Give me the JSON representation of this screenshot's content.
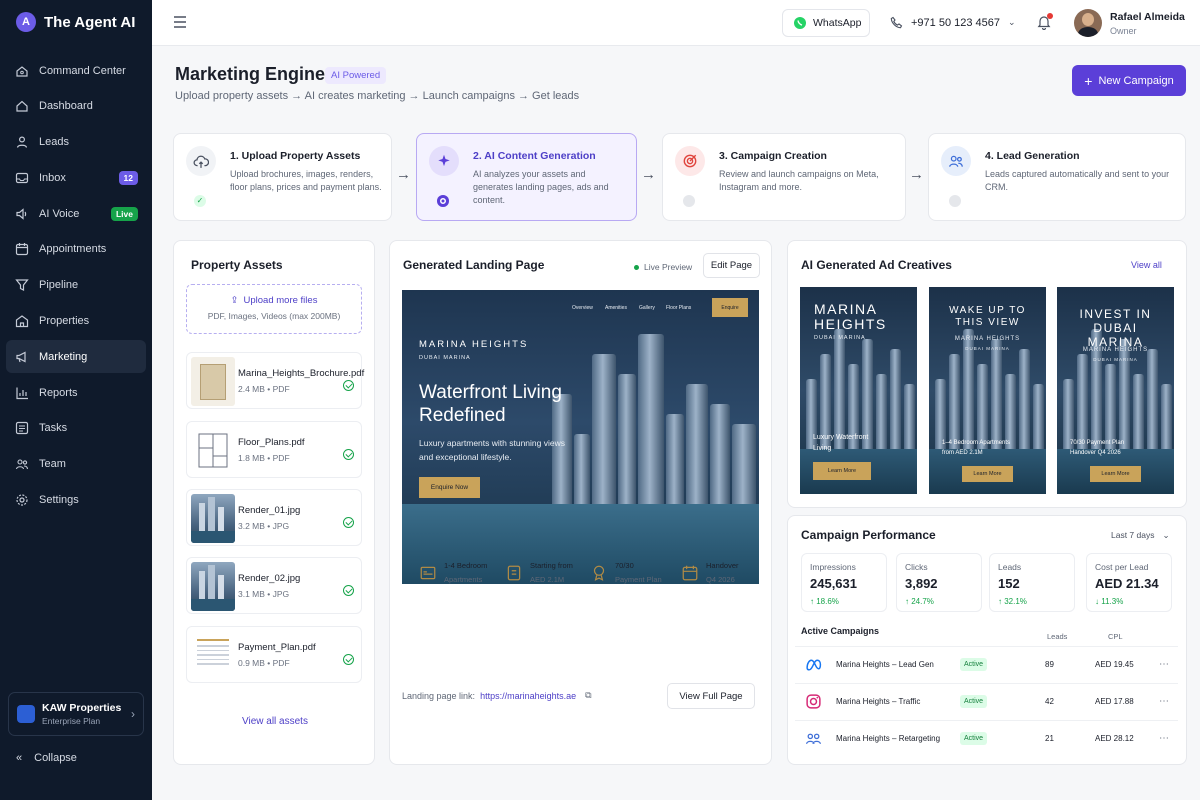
{
  "app": {
    "name": "The Agent AI",
    "logo_mark": "A"
  },
  "sidebar": {
    "items": [
      {
        "label": "Command Center",
        "icon": "home-icon"
      },
      {
        "label": "Dashboard",
        "icon": "dashboard-icon"
      },
      {
        "label": "Leads",
        "icon": "user-icon"
      },
      {
        "label": "Inbox",
        "icon": "inbox-icon",
        "badge": "12"
      },
      {
        "label": "AI Voice",
        "icon": "voice-icon",
        "badge": "Live"
      },
      {
        "label": "Appointments",
        "icon": "calendar-icon"
      },
      {
        "label": "Pipeline",
        "icon": "filter-icon"
      },
      {
        "label": "Properties",
        "icon": "building-icon"
      },
      {
        "label": "Marketing",
        "icon": "megaphone-icon",
        "active": true
      },
      {
        "label": "Reports",
        "icon": "chart-icon"
      },
      {
        "label": "Tasks",
        "icon": "tasks-icon"
      },
      {
        "label": "Team",
        "icon": "team-icon"
      },
      {
        "label": "Settings",
        "icon": "gear-icon"
      }
    ],
    "workspace": {
      "name": "KAW Properties",
      "plan": "Enterprise Plan"
    },
    "collapse_label": "Collapse"
  },
  "topbar": {
    "whatsapp_label": "WhatsApp",
    "phone": "+971 50 123 4567",
    "user": {
      "name": "Rafael Almeida",
      "role": "Owner"
    }
  },
  "header": {
    "title": "Marketing Engine",
    "badge": "AI Powered",
    "subtitle": "Upload property assets → AI creates marketing → Launch campaigns → Get leads",
    "new_campaign_label": "New Campaign"
  },
  "steps": [
    {
      "title": "1. Upload Property Assets",
      "desc": "Upload brochures, images, renders, floor plans, prices and payment plans.",
      "status": "done"
    },
    {
      "title": "2. AI Content Generation",
      "desc": "AI analyzes your assets and generates landing pages, ads and content.",
      "status": "active"
    },
    {
      "title": "3. Campaign Creation",
      "desc": "Review and launch campaigns on Meta, Instagram and more.",
      "status": "pending"
    },
    {
      "title": "4. Lead Generation",
      "desc": "Leads captured automatically and sent to your CRM.",
      "status": "pending"
    }
  ],
  "assets": {
    "title": "Property Assets",
    "upload_label": "Upload more files",
    "upload_hint": "PDF, Images, Videos (max 200MB)",
    "files": [
      {
        "name": "Marina_Heights_Brochure.pdf",
        "size": "2.4 MB",
        "type": "PDF",
        "thumb": "brochure"
      },
      {
        "name": "Floor_Plans.pdf",
        "size": "1.8 MB",
        "type": "PDF",
        "thumb": "floorplan"
      },
      {
        "name": "Render_01.jpg",
        "size": "3.2 MB",
        "type": "JPG",
        "thumb": "render"
      },
      {
        "name": "Render_02.jpg",
        "size": "3.1 MB",
        "type": "JPG",
        "thumb": "render"
      },
      {
        "name": "Payment_Plan.pdf",
        "size": "0.9 MB",
        "type": "PDF",
        "thumb": "document"
      }
    ],
    "view_all_label": "View all assets"
  },
  "landing": {
    "title": "Generated Landing Page",
    "live_label": "Live Preview",
    "edit_label": "Edit Page",
    "preview": {
      "nav": [
        "Overview",
        "Amenities",
        "Gallery",
        "Floor Plans"
      ],
      "enquire_label": "Enquire",
      "brand": "MARINA HEIGHTS",
      "location": "DUBAI MARINA",
      "headline": "Waterfront Living Redefined",
      "body": "Luxury apartments with stunning views and exceptional lifestyle.",
      "cta": "Enquire Now"
    },
    "features": [
      {
        "l1": "1-4 Bedroom",
        "l2": "Apartments",
        "icon": "bed-icon"
      },
      {
        "l1": "Starting from",
        "l2": "AED 2.1M",
        "icon": "price-tag-icon"
      },
      {
        "l1": "70/30",
        "l2": "Payment Plan",
        "icon": "payment-plan-icon"
      },
      {
        "l1": "Handover",
        "l2": "Q4 2026",
        "icon": "calendar-icon"
      }
    ],
    "link_label": "Landing page link:",
    "link_url": "https://marinaheights.ae",
    "view_full_label": "View Full Page"
  },
  "ads": {
    "title": "AI Generated Ad Creatives",
    "view_all_label": "View all",
    "creatives": [
      {
        "headline": "MARINA HEIGHTS",
        "sub": "DUBAI MARINA",
        "brand": "",
        "copy": "Luxury Waterfront Living",
        "cta": "Learn More"
      },
      {
        "headline": "WAKE UP TO THIS VIEW",
        "sub": "DUBAI MARINA",
        "brand": "MARINA HEIGHTS",
        "copy": "1–4 Bedroom Apartments from AED 2.1M",
        "cta": "Learn More"
      },
      {
        "headline": "INVEST IN DUBAI MARINA",
        "sub": "DUBAI MARINA",
        "brand": "MARINA HEIGHTS",
        "copy": "70/30 Payment Plan Handover Q4 2026",
        "cta": "Learn More"
      }
    ]
  },
  "performance": {
    "title": "Campaign Performance",
    "range": "Last 7 days",
    "metrics": [
      {
        "label": "Impressions",
        "value": "245,631",
        "delta": "18.6%",
        "dir": "up"
      },
      {
        "label": "Clicks",
        "value": "3,892",
        "delta": "24.7%",
        "dir": "up"
      },
      {
        "label": "Leads",
        "value": "152",
        "delta": "32.1%",
        "dir": "up"
      },
      {
        "label": "Cost per Lead",
        "value": "AED 21.34",
        "delta": "11.3%",
        "dir": "down"
      }
    ],
    "active_title": "Active Campaigns",
    "col_leads": "Leads",
    "col_cpl": "CPL",
    "campaigns": [
      {
        "name": "Marina Heights – Lead Gen",
        "status": "Active",
        "leads": "89",
        "cpl": "AED 19.45",
        "platform": "meta-icon"
      },
      {
        "name": "Marina Heights – Traffic",
        "status": "Active",
        "leads": "42",
        "cpl": "AED 17.88",
        "platform": "instagram-icon"
      },
      {
        "name": "Marina Heights – Retargeting",
        "status": "Active",
        "leads": "21",
        "cpl": "AED 28.12",
        "platform": "audience-icon"
      }
    ]
  },
  "colors": {
    "accent": "#5b3fd8",
    "sidebar": "#0f1a2b",
    "success": "#16a34a",
    "gold": "#c9a35a"
  }
}
